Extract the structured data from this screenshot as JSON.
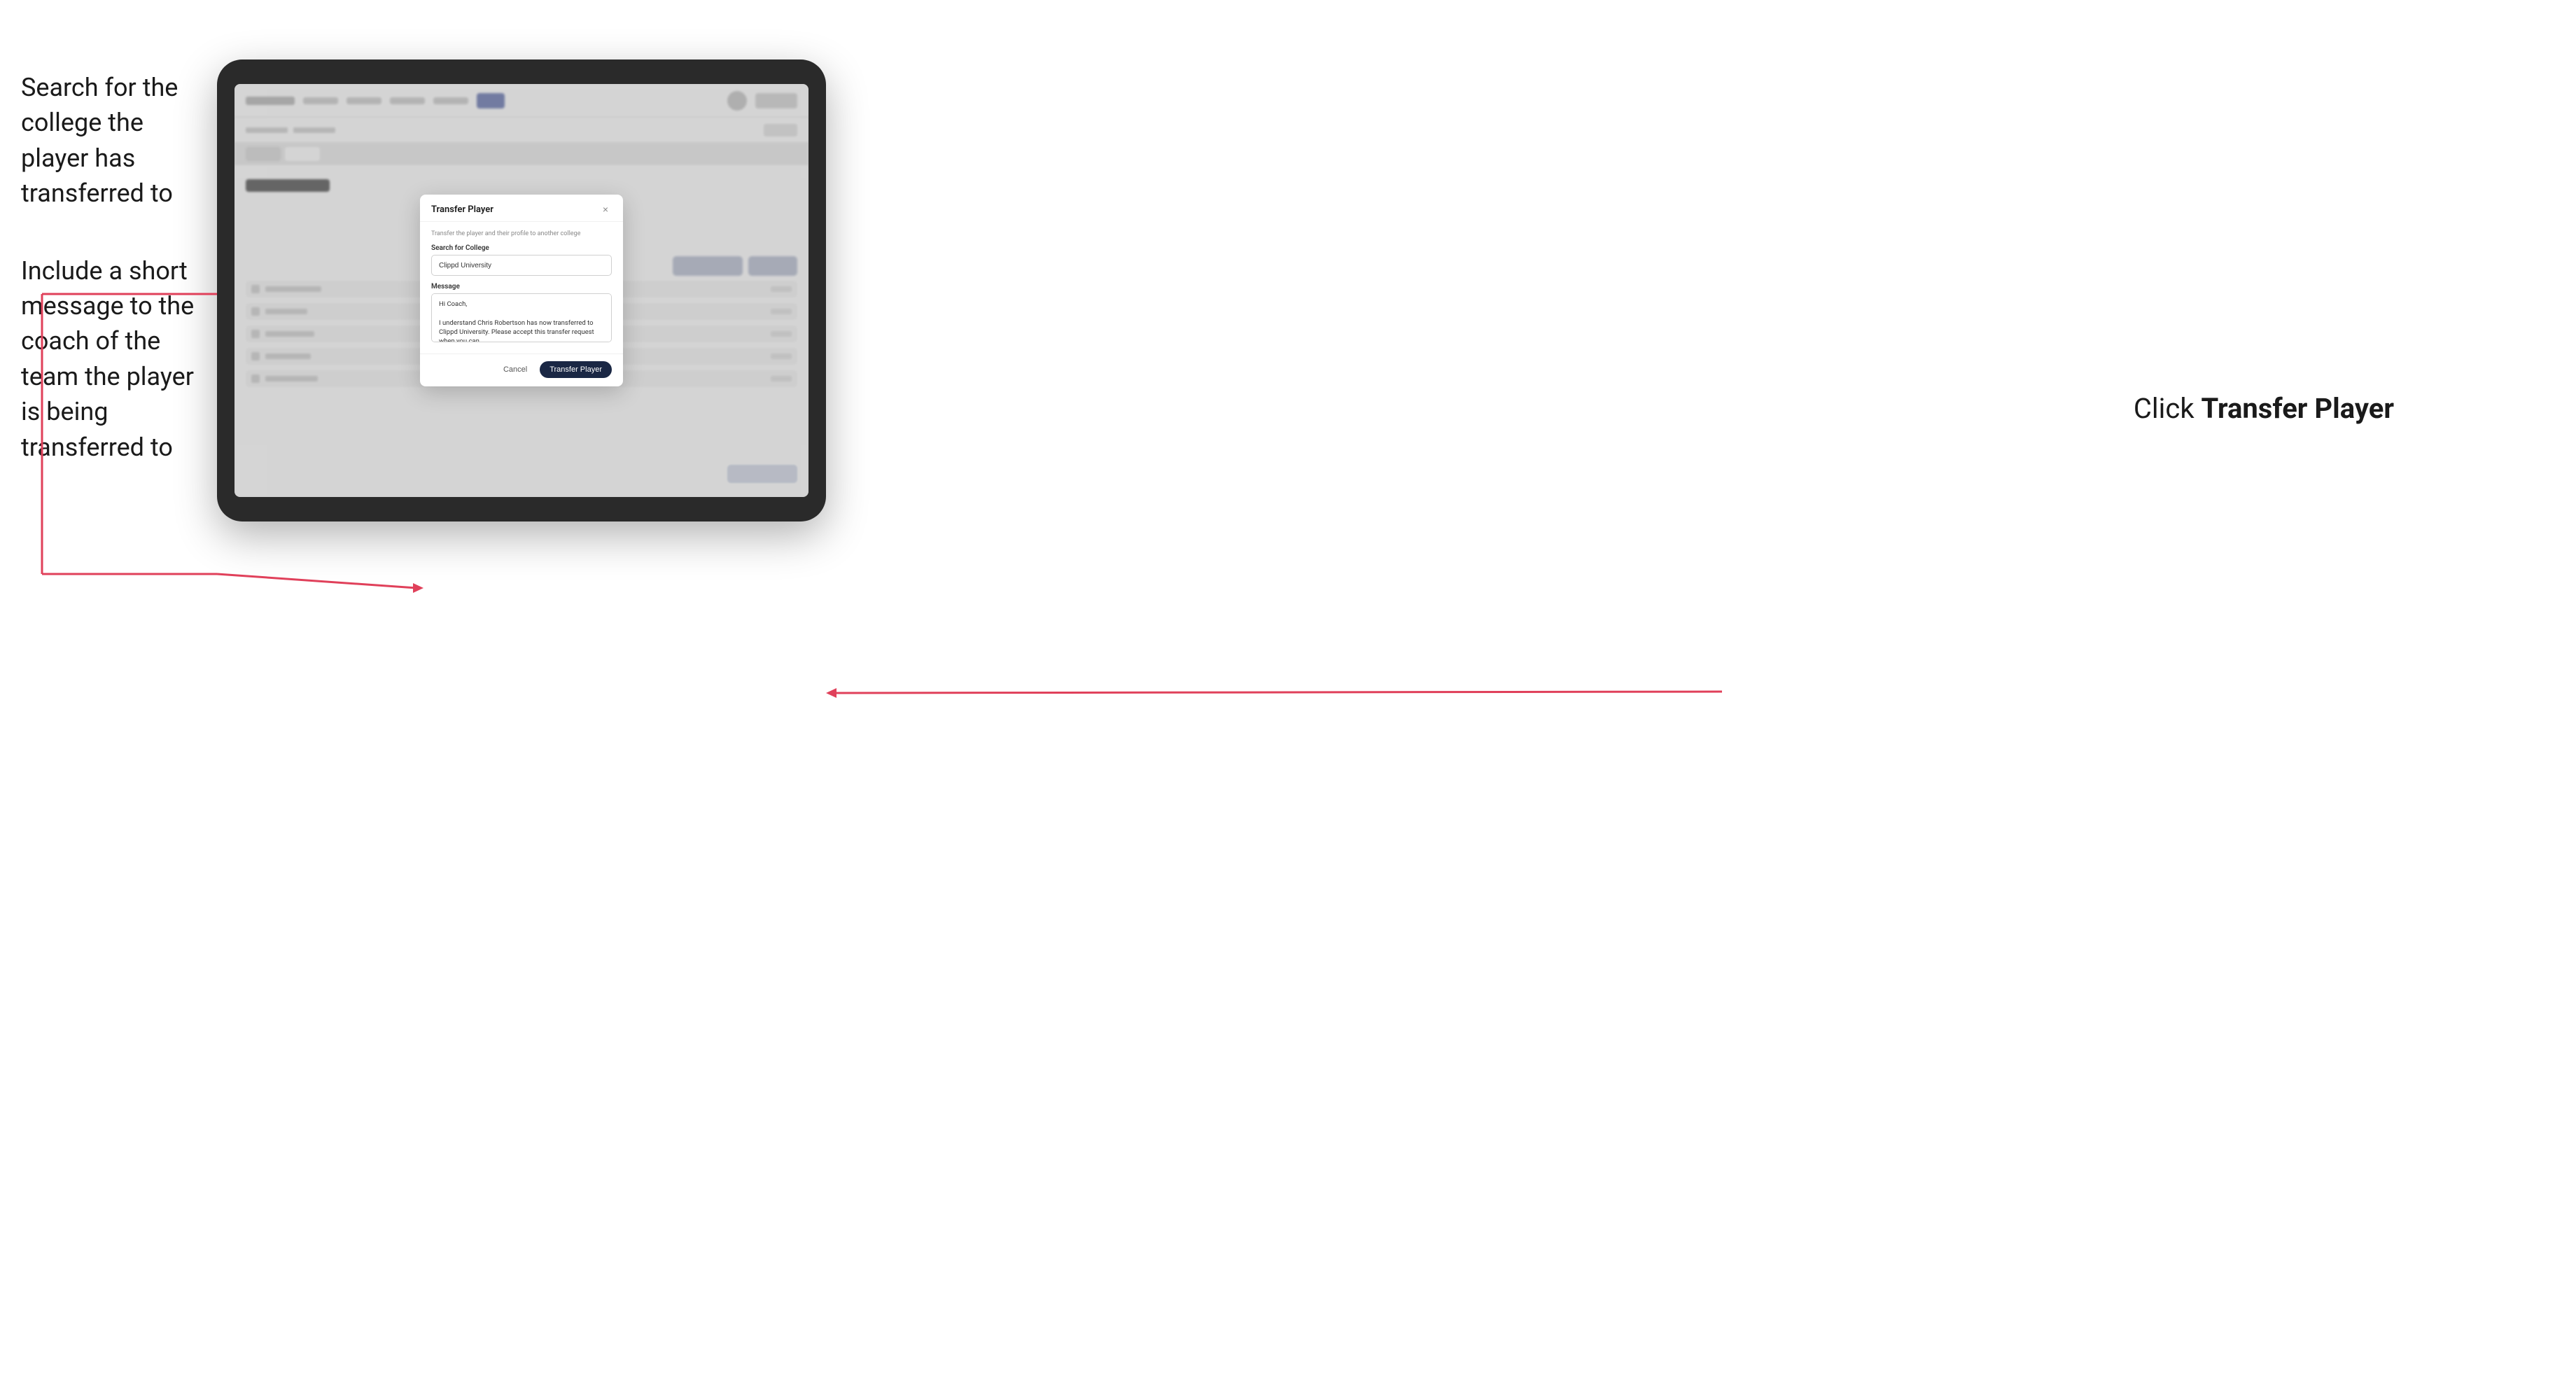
{
  "annotations": {
    "left_top": "Search for the college the player has transferred to",
    "left_bottom": "Include a short message to the coach of the team the player is being transferred to",
    "right": "Click Transfer Player"
  },
  "modal": {
    "title": "Transfer Player",
    "subtitle": "Transfer the player and their profile to another college",
    "search_label": "Search for College",
    "search_value": "Clippd University",
    "message_label": "Message",
    "message_value": "Hi Coach,\n\nI understand Chris Robertson has now transferred to Clippd University. Please accept this transfer request when you can.",
    "cancel_label": "Cancel",
    "transfer_label": "Transfer Player",
    "close_icon": "×"
  },
  "app": {
    "roster_title": "Update Roster"
  }
}
